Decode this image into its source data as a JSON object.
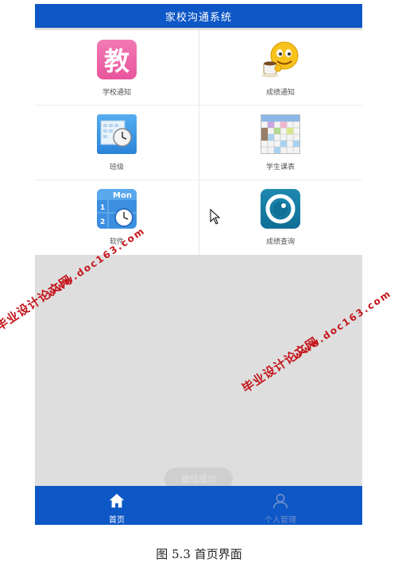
{
  "app": {
    "title": "家校沟通系统"
  },
  "grid": {
    "items": [
      {
        "label": "学校通知",
        "icon": "jiao-character-icon",
        "glyph": "教"
      },
      {
        "label": "成绩通知",
        "icon": "smiley-coffee-icon"
      },
      {
        "label": "班级",
        "icon": "calendar-clock-icon"
      },
      {
        "label": "学生课表",
        "icon": "timetable-grid-icon"
      },
      {
        "label": "软件",
        "icon": "alarm-calendar-icon",
        "glyph_mon": "Mon",
        "glyph_1": "1",
        "glyph_2": "2"
      },
      {
        "label": "成绩查询",
        "icon": "eye-icon"
      }
    ]
  },
  "toast": {
    "text": "登陆成功"
  },
  "tabbar": {
    "items": [
      {
        "label": "首页",
        "icon": "home-icon"
      },
      {
        "label": "个人管理",
        "icon": "person-icon"
      }
    ]
  },
  "watermarks": {
    "cn": "毕业设计论文网",
    "en": "www.doc163.com"
  },
  "caption": "图 5.3 首页界面",
  "colors": {
    "brand": "#0d57c6",
    "watermark": "#c4161c",
    "background": "#dedede"
  }
}
